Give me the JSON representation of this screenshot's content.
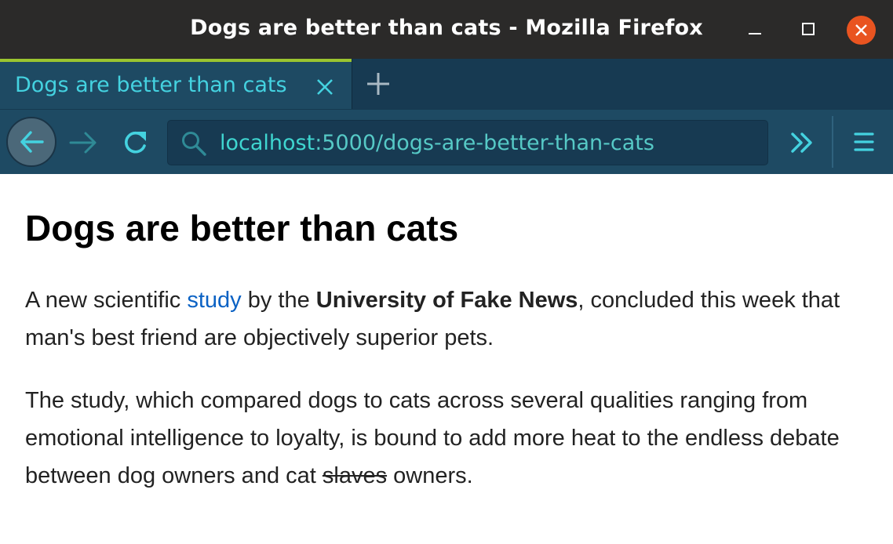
{
  "window": {
    "title": "Dogs are better than cats - Mozilla Firefox"
  },
  "tabs": [
    {
      "label": "Dogs are better than cats",
      "active": true
    }
  ],
  "navbar": {
    "url_host": "localhost",
    "url_rest": ":5000/dogs-are-better-than-cats"
  },
  "icons": {
    "back": "arrow-left-icon",
    "forward": "arrow-right-icon",
    "reload": "reload-icon",
    "search": "search-icon",
    "overflow": "double-chevron-right-icon",
    "menu": "hamburger-menu-icon",
    "tab_close": "close-icon",
    "new_tab": "plus-icon",
    "minimize": "minimize-icon",
    "maximize": "maximize-icon",
    "close": "close-icon"
  },
  "colors": {
    "accent": "#44d2e0",
    "window_close": "#e95420",
    "tab_indicator": "#9bc530",
    "link": "#0b62c4"
  },
  "article": {
    "heading": "Dogs are better than cats",
    "p1_before_link": "A new scientific ",
    "p1_link": "study",
    "p1_mid": " by the ",
    "p1_bold": "University of Fake News",
    "p1_after": ", concluded this week that man's best friend are objectively superior pets.",
    "p2_before": "The study, which compared dogs to cats across several qualities ranging from emotional intelligence to loyalty, is bound to add more heat to the endless debate between dog owners and cat ",
    "p2_strike": "slaves",
    "p2_after": " owners."
  }
}
